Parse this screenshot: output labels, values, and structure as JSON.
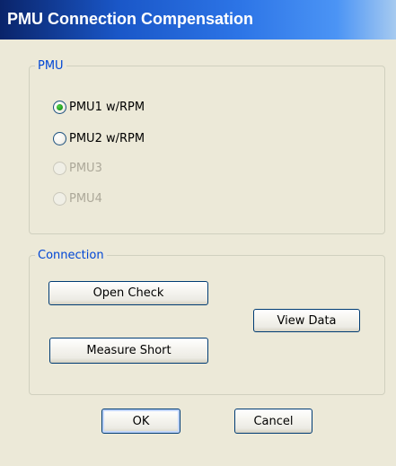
{
  "window": {
    "title": "PMU Connection Compensation"
  },
  "pmu_group": {
    "legend": "PMU",
    "options": [
      {
        "label": "PMU1 w/RPM",
        "selected": true,
        "enabled": true
      },
      {
        "label": "PMU2 w/RPM",
        "selected": false,
        "enabled": true
      },
      {
        "label": "PMU3",
        "selected": false,
        "enabled": false
      },
      {
        "label": "PMU4",
        "selected": false,
        "enabled": false
      }
    ]
  },
  "connection_group": {
    "legend": "Connection",
    "open_check_label": "Open Check",
    "measure_short_label": "Measure Short",
    "view_data_label": "View Data"
  },
  "footer": {
    "ok_label": "OK",
    "cancel_label": "Cancel"
  },
  "colors": {
    "title_bar": "#1a57c8",
    "group_legend": "#0046d5",
    "dialog_bg": "#ece9d8",
    "radio_selected_dot": "#21a121",
    "disabled_text": "#aca899"
  }
}
